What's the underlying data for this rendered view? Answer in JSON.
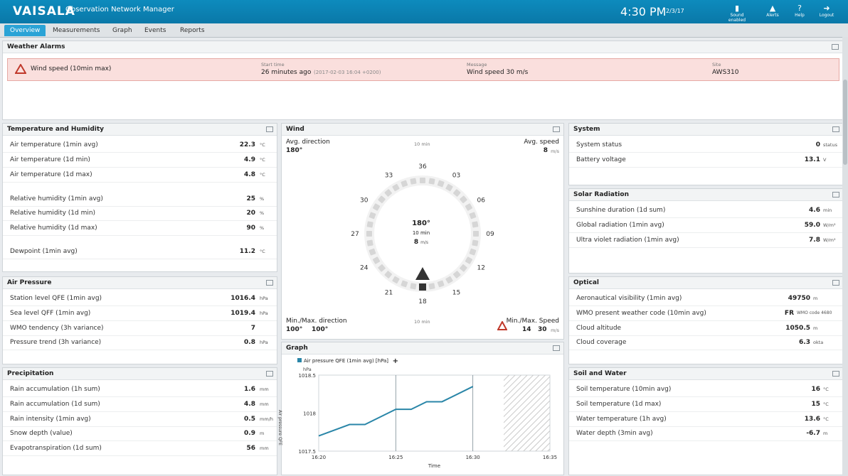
{
  "header": {
    "logo": "VAISALA",
    "app_title": "Observation Network Manager",
    "time": "4:30 PM",
    "date": "2/3/17",
    "buttons": [
      {
        "label": "Sound enabled",
        "icon": "speaker-icon"
      },
      {
        "label": "Alerts",
        "icon": "alert-icon"
      },
      {
        "label": "Help",
        "icon": "help-icon"
      },
      {
        "label": "Logout",
        "icon": "logout-icon"
      }
    ]
  },
  "tabs": [
    "Overview",
    "Measurements",
    "Graph",
    "Events",
    "Reports"
  ],
  "weather_alarms": {
    "title": "Weather Alarms",
    "name": "Wind speed (10min max)",
    "start_time_caption": "Start time",
    "start_time": "26 minutes ago",
    "start_time_detail": "(2017-02-03 16:04 +0200)",
    "message_caption": "Message",
    "message": "Wind speed 30 m/s",
    "site_caption": "Site",
    "site": "AWS310"
  },
  "temperature_humidity": {
    "title": "Temperature and Humidity",
    "rows": [
      {
        "label": "Air temperature (1min avg)",
        "value": "22.3",
        "unit": "°C"
      },
      {
        "label": "Air temperature (1d min)",
        "value": "4.9",
        "unit": "°C"
      },
      {
        "label": "Air temperature (1d max)",
        "value": "4.8",
        "unit": "°C"
      },
      {
        "label": "Relative humidity (1min avg)",
        "value": "25",
        "unit": "%"
      },
      {
        "label": "Relative humidity (1d min)",
        "value": "20",
        "unit": "%"
      },
      {
        "label": "Relative humidity (1d max)",
        "value": "90",
        "unit": "%"
      },
      {
        "label": "Dewpoint (1min avg)",
        "value": "11.2",
        "unit": "°C"
      }
    ]
  },
  "air_pressure": {
    "title": "Air Pressure",
    "rows": [
      {
        "label": "Station level QFE (1min avg)",
        "value": "1016.4",
        "unit": "hPa"
      },
      {
        "label": "Sea level QFF (1min avg)",
        "value": "1019.4",
        "unit": "hPa"
      },
      {
        "label": "WMO tendency (3h variance)",
        "value": "7",
        "unit": ""
      },
      {
        "label": "Pressure trend (3h variance)",
        "value": "0.8",
        "unit": "hPa"
      }
    ]
  },
  "precipitation": {
    "title": "Precipitation",
    "rows": [
      {
        "label": "Rain accumulation (1h sum)",
        "value": "1.6",
        "unit": "mm"
      },
      {
        "label": "Rain accumulation (1d sum)",
        "value": "4.8",
        "unit": "mm"
      },
      {
        "label": "Rain intensity (1min avg)",
        "value": "0.5",
        "unit": "mm/h"
      },
      {
        "label": "Snow depth (value)",
        "value": "0.9",
        "unit": "m"
      },
      {
        "label": "Evapotranspiration (1d sum)",
        "value": "56",
        "unit": "mm"
      }
    ]
  },
  "wind": {
    "title": "Wind",
    "avg_direction_label": "Avg. direction",
    "avg_direction": "180°",
    "avg_speed_label": "Avg. speed",
    "avg_speed": "8",
    "avg_speed_unit": "m/s",
    "top_caption": "10 min",
    "center_direction": "180°",
    "center_period": "10 min",
    "center_speed": "8",
    "center_speed_unit": "m/s",
    "bottom_caption": "10 min",
    "minmax_direction_label": "Min./Max. direction",
    "min_direction": "100°",
    "max_direction": "100°",
    "minmax_speed_label": "Min./Max. Speed",
    "min_speed": "14",
    "max_speed": "30",
    "speed_unit": "m/s",
    "compass_labels": [
      "36",
      "03",
      "06",
      "09",
      "12",
      "15",
      "18",
      "21",
      "24",
      "27",
      "30",
      "33"
    ]
  },
  "graph": {
    "title": "Graph",
    "legend": "Air pressure QFE (1min avg) [hPa]",
    "add_label": "+",
    "ylabel": "hPa",
    "xlabel": "Time",
    "y_axis_text": "Air pressure QFE",
    "y_ticks": [
      "1017.5",
      "1018",
      "1018.5"
    ],
    "x_ticks": [
      "16:20",
      "16:25",
      "16:30",
      "16:35"
    ]
  },
  "chart_data": {
    "type": "line",
    "title": "",
    "xlabel": "Time",
    "ylabel": "hPa",
    "series": [
      {
        "name": "Air pressure QFE (1min avg) [hPa]",
        "x": [
          "16:20",
          "16:22",
          "16:23",
          "16:25",
          "16:26",
          "16:27",
          "16:28",
          "16:30"
        ],
        "values": [
          1017.7,
          1017.85,
          1017.85,
          1018.05,
          1018.05,
          1018.15,
          1018.15,
          1018.35
        ]
      }
    ],
    "ylim": [
      1017.5,
      1018.5
    ],
    "xlim": [
      "16:20",
      "16:35"
    ],
    "grid": false,
    "legend": "top-left",
    "line_color": "#2a86a8"
  },
  "system": {
    "title": "System",
    "rows": [
      {
        "label": "System status",
        "value": "0",
        "unit": "status"
      },
      {
        "label": "Battery voltage",
        "value": "13.1",
        "unit": "V"
      }
    ]
  },
  "solar_radiation": {
    "title": "Solar Radiation",
    "rows": [
      {
        "label": "Sunshine duration (1d sum)",
        "value": "4.6",
        "unit": "min"
      },
      {
        "label": "Global radiation (1min avg)",
        "value": "59.0",
        "unit": "W/m²"
      },
      {
        "label": "Ultra violet radiation (1min avg)",
        "value": "7.8",
        "unit": "W/m²"
      }
    ]
  },
  "optical": {
    "title": "Optical",
    "rows": [
      {
        "label": "Aeronautical visibility (1min avg)",
        "value": "49750",
        "unit": "m"
      },
      {
        "label": "WMO present weather code (10min avg)",
        "value": "FR",
        "unit": "WMO code 4680"
      },
      {
        "label": "Cloud altitude",
        "value": "1050.5",
        "unit": "m"
      },
      {
        "label": "Cloud coverage",
        "value": "6.3",
        "unit": "okta"
      }
    ]
  },
  "soil_water": {
    "title": "Soil and Water",
    "rows": [
      {
        "label": "Soil temperature (10min avg)",
        "value": "16",
        "unit": "°C"
      },
      {
        "label": "Soil temperature (1d max)",
        "value": "15",
        "unit": "°C"
      },
      {
        "label": "Water temperature (1h avg)",
        "value": "13.6",
        "unit": "°C"
      },
      {
        "label": "Water depth (3min avg)",
        "value": "-6.7",
        "unit": "m"
      }
    ]
  }
}
